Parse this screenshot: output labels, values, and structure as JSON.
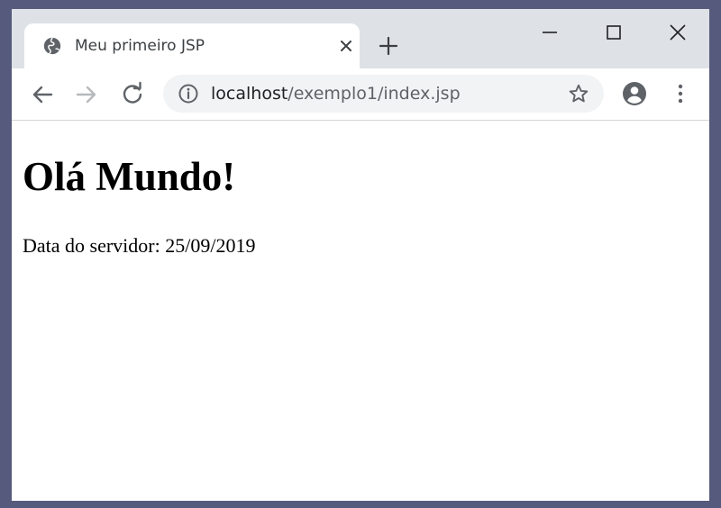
{
  "browser": {
    "tab": {
      "title": "Meu primeiro JSP",
      "favicon": "globe-icon"
    },
    "address_bar": {
      "host": "localhost",
      "path": "/exemplo1/index.jsp",
      "info_icon": "info-icon"
    },
    "toolbar_icons": [
      "back-arrow-icon",
      "forward-arrow-icon",
      "reload-icon",
      "star-icon",
      "profile-icon",
      "menu-dots-icon"
    ],
    "window_controls": [
      "minimize-icon",
      "maximize-icon",
      "close-icon"
    ]
  },
  "page": {
    "heading": "Olá Mundo!",
    "paragraph": "Data do servidor: 25/09/2019"
  },
  "colors": {
    "desktop_background": "#565a7c",
    "tabstrip_background": "#dee1e6",
    "omnibox_background": "#f1f3f4",
    "icon_color": "#5f6368"
  }
}
